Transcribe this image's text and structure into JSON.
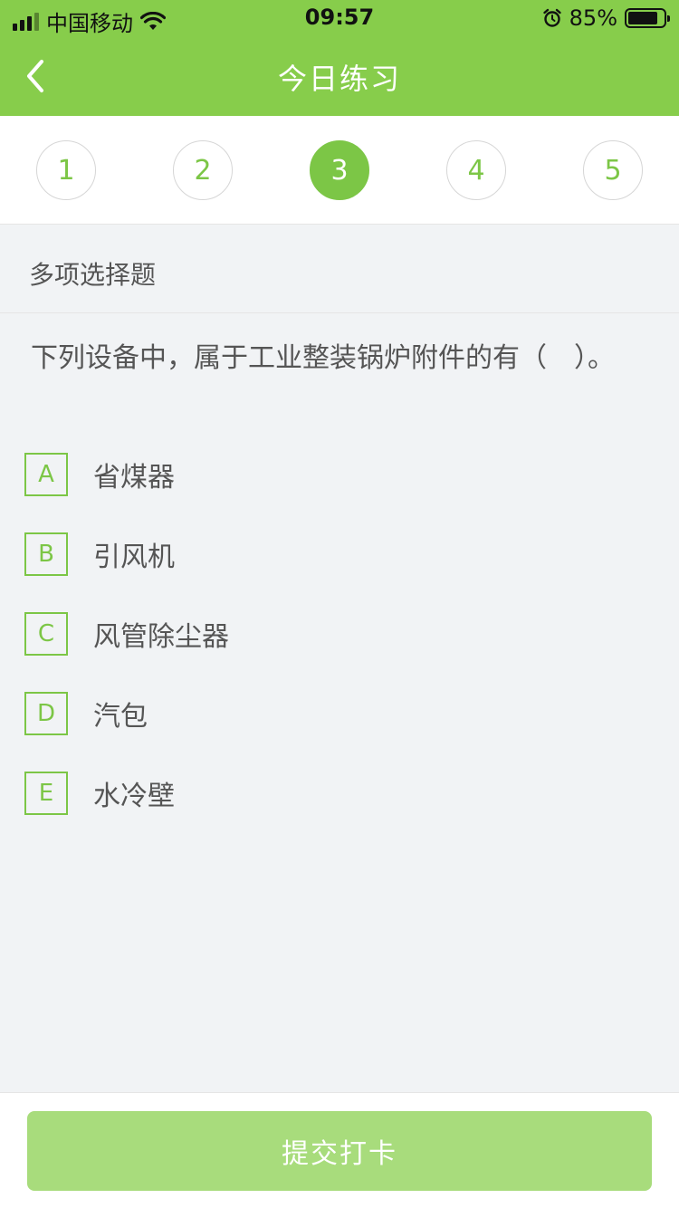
{
  "status_bar": {
    "carrier": "中国移动",
    "time": "09:57",
    "battery_percent": "85%",
    "battery_level": 0.85,
    "icons": [
      "signal-icon",
      "wifi-icon",
      "alarm-icon",
      "battery-icon"
    ]
  },
  "nav": {
    "title": "今日练习",
    "back_icon": "chevron-left-icon"
  },
  "steps": {
    "items": [
      "1",
      "2",
      "3",
      "4",
      "5"
    ],
    "active": "3"
  },
  "question": {
    "type_label": "多项选择题",
    "stem": "下列设备中，属于工业整装锅炉附件的有（　）。",
    "options": [
      {
        "letter": "A",
        "text": "省煤器"
      },
      {
        "letter": "B",
        "text": "引风机"
      },
      {
        "letter": "C",
        "text": "风管除尘器"
      },
      {
        "letter": "D",
        "text": "汽包"
      },
      {
        "letter": "E",
        "text": "水冷壁"
      }
    ]
  },
  "footer": {
    "submit_label": "提交打卡"
  },
  "colors": {
    "accent": "#87cd4b",
    "button": "#a8dc7c",
    "background": "#f1f3f5"
  }
}
